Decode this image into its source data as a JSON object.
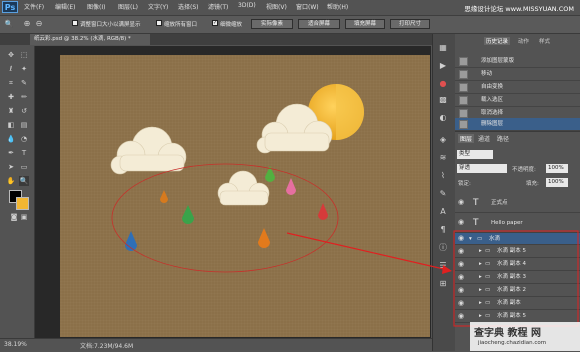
{
  "app": {
    "logo_text": "Ps",
    "watermark": "思缘设计论坛  www.MISSYUAN.COM"
  },
  "menu": [
    "文件(F)",
    "编辑(E)",
    "图像(I)",
    "图层(L)",
    "文字(Y)",
    "选择(S)",
    "滤镜(T)",
    "3D(D)",
    "视图(V)",
    "窗口(W)",
    "帮助(H)"
  ],
  "options": {
    "resize_windows": "调整窗口大小以满屏显示",
    "zoom_all": "缩放所有窗口",
    "scrubby_zoom": "细微缩放",
    "actual_pixels": "实际像素",
    "fit_screen": "适合屏幕",
    "fill_screen": "填充屏幕",
    "print_size": "打印尺寸"
  },
  "document": {
    "tab_label": "纸云彩.psd @ 38.2% (水滴, RGB/8) *",
    "zoom": "38.19%",
    "doc_info": "文档:7.23M/94.6M"
  },
  "panels": {
    "history_tabs": [
      "历史记录",
      "动作",
      "样式"
    ],
    "history": [
      "添加图层蒙版",
      "移动",
      "自由变换",
      "载入选区",
      "取消选择",
      "删除图层"
    ],
    "layers_tabs": [
      "图层",
      "通道",
      "路径"
    ],
    "kind": "类型",
    "blend_mode": "穿透",
    "opacity_label": "不透明度:",
    "opacity": "100%",
    "lock_label": "锁定:",
    "fill_label": "填充:",
    "fill": "100%",
    "layers": [
      {
        "name": "正式点",
        "type": "text"
      },
      {
        "name": "Hello paper",
        "type": "text"
      },
      {
        "name": "水滴",
        "type": "group"
      },
      {
        "name": "水滴 副本 5",
        "type": "group"
      },
      {
        "name": "水滴 副本 4",
        "type": "group"
      },
      {
        "name": "水滴 副本 3",
        "type": "group"
      },
      {
        "name": "水滴 副本 2",
        "type": "group"
      },
      {
        "name": "水滴 副本",
        "type": "group"
      },
      {
        "name": "水滴 副本 5",
        "type": "group"
      }
    ]
  },
  "footer_watermark": "查字典 教程 网",
  "footer_url": "jiaocheng.chazidian.com",
  "colors": {
    "canvas": "#8b7049",
    "sun": "#f2b632",
    "selection": "#3a5f8a",
    "highlight_box": "#e02020"
  }
}
